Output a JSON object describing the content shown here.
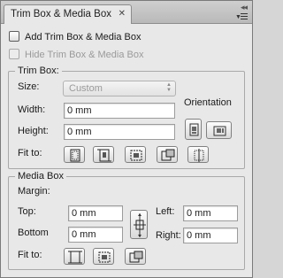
{
  "panel": {
    "tab_title": "Trim Box & Media Box",
    "close_glyph": "✕",
    "collapse_glyph": "◂◂"
  },
  "options": {
    "add_trim_media": {
      "label": "Add Trim Box & Media Box",
      "checked": false,
      "enabled": true
    },
    "hide_trim_media": {
      "label": "Hide Trim Box & Media Box",
      "checked": false,
      "enabled": false
    }
  },
  "trim_box": {
    "legend": "Trim Box:",
    "size_label": "Size:",
    "size_value": "Custom",
    "width_label": "Width:",
    "width_value": "0 mm",
    "height_label": "Height:",
    "height_value": "0 mm",
    "orientation_label": "Orientation",
    "fit_label": "Fit to:",
    "fit_icons": [
      "fit-page-icon",
      "fit-margins-icon",
      "fit-bleed-icon",
      "fit-selection-icon",
      "fit-custom-icon"
    ],
    "orientation_icons": [
      "portrait-icon",
      "landscape-icon"
    ]
  },
  "media_box": {
    "legend": "Media Box",
    "margin_label": "Margin:",
    "top_label": "Top:",
    "top_value": "0 mm",
    "bottom_label": "Bottom",
    "bottom_value": "0 mm",
    "left_label": "Left:",
    "left_value": "0 mm",
    "right_label": "Right:",
    "right_value": "0 mm",
    "fit_label": "Fit to:",
    "fit_icons": [
      "fit-page-icon",
      "fit-margins-icon",
      "fit-selection-icon"
    ],
    "link_icon": "link-margins-icon"
  },
  "colors": {
    "panel_bg": "#e8e8e8",
    "titlebar": "#c4c4c4",
    "disabled_text": "#9a9a9a"
  }
}
